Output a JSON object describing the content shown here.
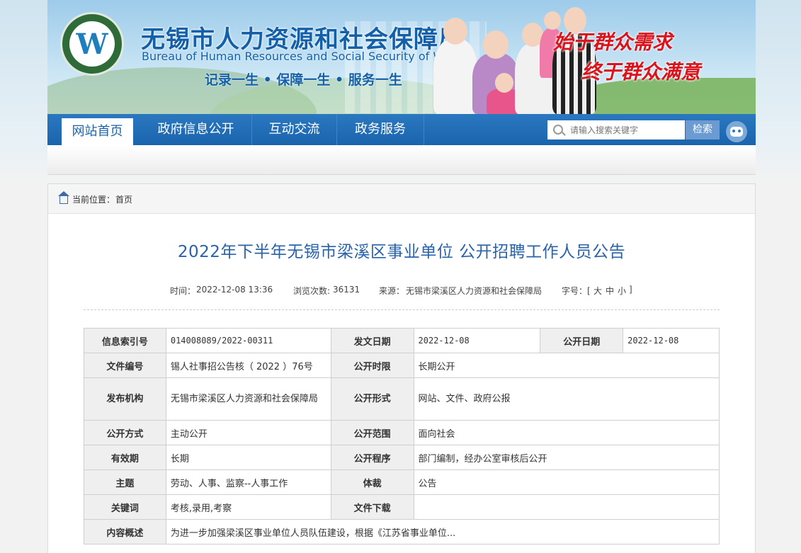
{
  "header": {
    "site_title_cn": "无锡市人力资源和社会保障局",
    "site_title_en": "Bureau of Human Resources and Social Security of WuXi",
    "slogan": "记录一生 • 保障一生 • 服务一生",
    "motto_line1": "始于群众需求",
    "motto_line2": "终于群众满意"
  },
  "nav": {
    "items": [
      {
        "label": "网站首页",
        "active": true
      },
      {
        "label": "政府信息公开"
      },
      {
        "label": "互动交流"
      },
      {
        "label": "政务服务"
      }
    ],
    "search_placeholder": "请输入搜索关键字",
    "search_button": "检索"
  },
  "breadcrumb": {
    "label": "当前位置：",
    "current": "首页"
  },
  "article": {
    "title": "2022年下半年无锡市梁溪区事业单位 公开招聘工作人员公告",
    "time_label": "时间：",
    "time": "2022-12-08 13:36",
    "views_label": "浏览次数:",
    "views": "36131",
    "source_label": "来源：",
    "source": "无锡市梁溪区人力资源和社会保障局",
    "font_size_label": "字号：[",
    "font_large": "大",
    "font_medium": "中",
    "font_small": "小",
    "font_size_end": "]"
  },
  "info": {
    "index_no_label": "信息索引号",
    "index_no": "014008089/2022-00311",
    "issue_date_label": "发文日期",
    "issue_date": "2022-12-08",
    "open_date_label": "公开日期",
    "open_date": "2022-12-08",
    "doc_no_label": "文件编号",
    "doc_no": "锡人社事招公告核（ 2022 ）76号",
    "open_period_label": "公开时限",
    "open_period": "长期公开",
    "publisher_label": "发布机构",
    "publisher": "无锡市梁溪区人力资源和社会保障局",
    "open_form_label": "公开形式",
    "open_form": "网站、文件、政府公报",
    "open_mode_label": "公开方式",
    "open_mode": "主动公开",
    "open_scope_label": "公开范围",
    "open_scope": "面向社会",
    "validity_label": "有效期",
    "validity": "长期",
    "open_procedure_label": "公开程序",
    "open_procedure": "部门编制，经办公室审核后公开",
    "subject_label": "主题",
    "subject": "劳动、人事、监察--人事工作",
    "genre_label": "体裁",
    "genre": "公告",
    "keywords_label": "关键词",
    "keywords": "考核,录用,考察",
    "download_label": "文件下载",
    "download": "",
    "summary_label": "内容概述",
    "summary": "为进一步加强梁溪区事业单位人员队伍建设，根据《江苏省事业单位..."
  }
}
